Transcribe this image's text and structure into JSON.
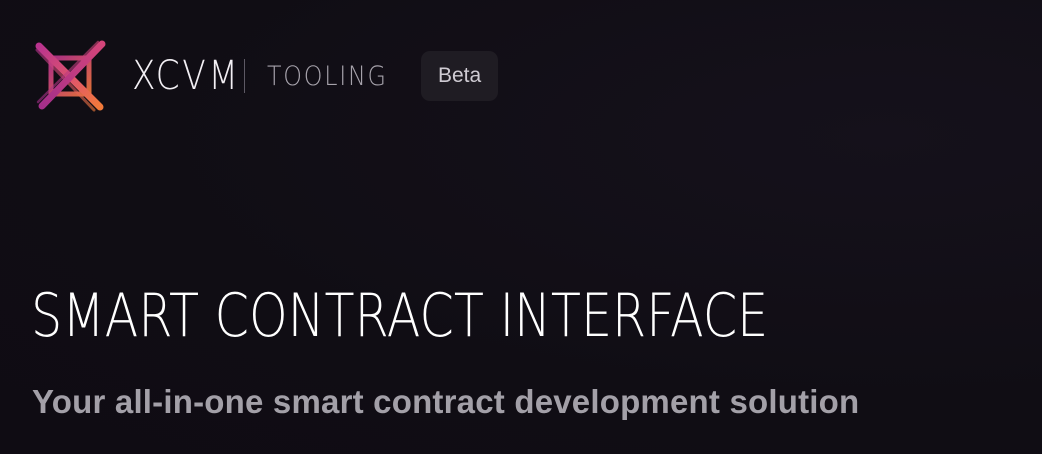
{
  "header": {
    "logo_icon": "xcvm-logo-icon",
    "brand": "XCVM",
    "subbrand": "TOOLING",
    "badge": "Beta"
  },
  "hero": {
    "title": "SMART CONTRACT INTERFACE",
    "subtitle": "Your all-in-one smart contract development solution"
  },
  "colors": {
    "background": "#100d14",
    "badge_bg": "#1f1c23",
    "logo_gradient_start": "#c13a8e",
    "logo_gradient_end": "#f0733c"
  }
}
